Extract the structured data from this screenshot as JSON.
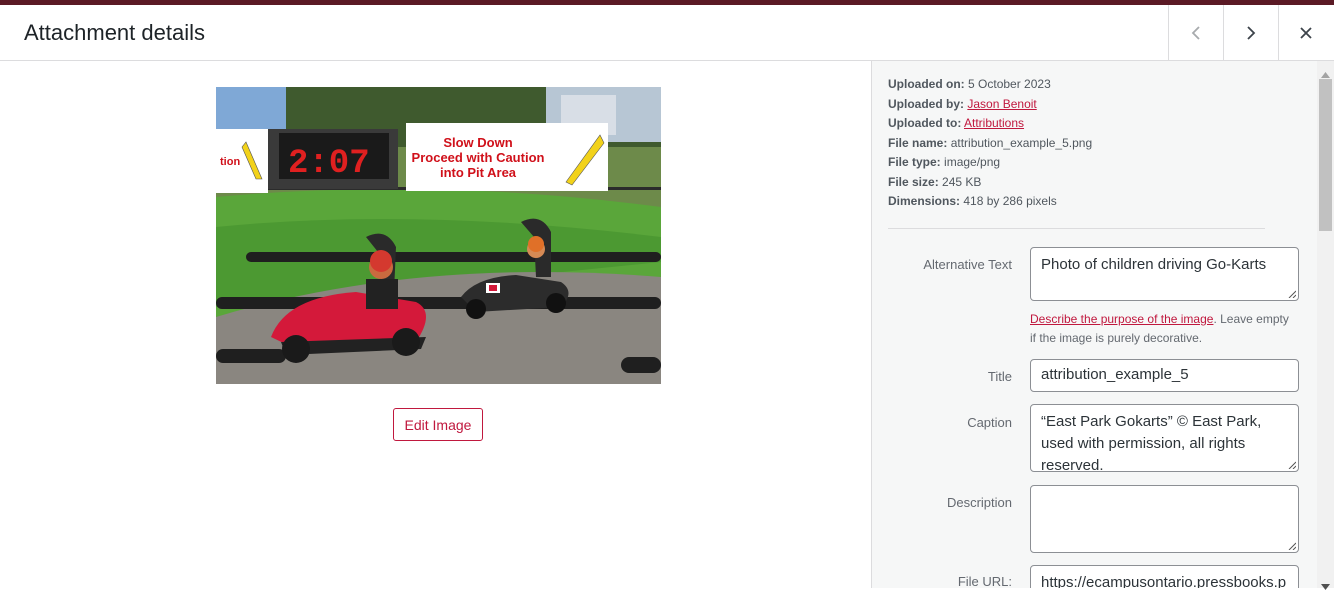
{
  "header": {
    "title": "Attachment details",
    "prev_icon": "chevron-left-icon",
    "next_icon": "chevron-right-icon",
    "close_icon": "close-icon"
  },
  "image": {
    "sign_text": "Slow Down\nProceed with Caution\ninto Pit Area",
    "sign_left_text": "c\ntion",
    "timer": "2:07",
    "edit_label": "Edit Image"
  },
  "meta": {
    "uploaded_on_label": "Uploaded on:",
    "uploaded_on": "5 October 2023",
    "uploaded_by_label": "Uploaded by:",
    "uploaded_by": "Jason Benoit",
    "uploaded_to_label": "Uploaded to:",
    "uploaded_to": "Attributions",
    "file_name_label": "File name:",
    "file_name": "attribution_example_5.png",
    "file_type_label": "File type:",
    "file_type": "image/png",
    "file_size_label": "File size:",
    "file_size": "245 KB",
    "dimensions_label": "Dimensions:",
    "dimensions": "418 by 286 pixels"
  },
  "fields": {
    "alt_label": "Alternative Text",
    "alt_value": "Photo of children driving Go-Karts",
    "alt_help_link": "Describe the purpose of the image",
    "alt_help_text": ". Leave empty if the image is purely decorative.",
    "title_label": "Title",
    "title_value": "attribution_example_5",
    "caption_label": "Caption",
    "caption_value": "“East Park Gokarts” © East Park, used with permission, all rights reserved.",
    "description_label": "Description",
    "description_value": "",
    "file_url_label": "File URL:",
    "file_url_value": "https://ecampusontario.pressbooks.p"
  },
  "colors": {
    "accent": "#c0183e",
    "top_strip": "#5b1a25"
  }
}
